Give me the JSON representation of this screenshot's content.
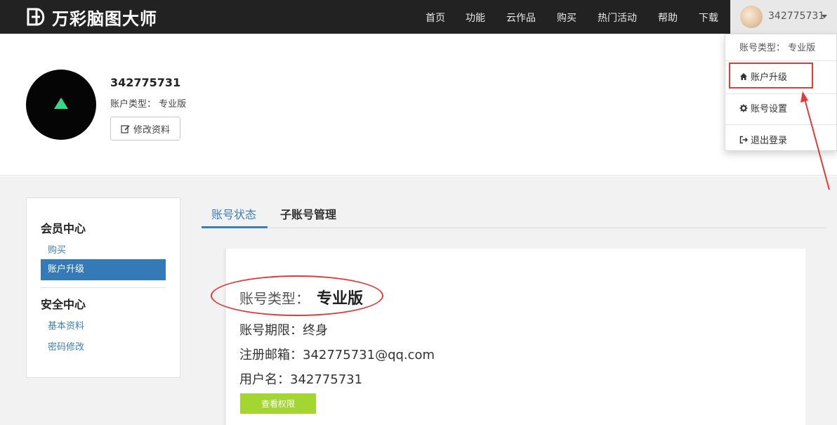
{
  "app": {
    "logo_text": "万彩脑图大师"
  },
  "nav": {
    "items": [
      "首页",
      "功能",
      "云作品",
      "购买",
      "热门活动",
      "帮助",
      "下载"
    ],
    "user_name": "342775731"
  },
  "dropdown": {
    "account_type": "账号类型： 专业版",
    "items": [
      {
        "label": "账户升级",
        "icon": "home-icon"
      },
      {
        "label": "账号设置",
        "icon": "gear-icon"
      },
      {
        "label": "退出登录",
        "icon": "logout-icon"
      }
    ]
  },
  "profile": {
    "name": "342775731",
    "account_type": "账户类型： 专业版",
    "edit_label": "修改资料"
  },
  "sidebar": {
    "member_heading": "会员中心",
    "buy": "购买",
    "upgrade": "账户升级",
    "security_heading": "安全中心",
    "basic_info": "基本资料",
    "password": "密码修改"
  },
  "tabs": {
    "status": "账号状态",
    "sub_accounts": "子账号管理"
  },
  "account": {
    "type_label": "账号类型：",
    "type_value": "专业版",
    "period": "账号期限：终身",
    "email": "注册邮箱：342775731@qq.com",
    "username": "用户名：342775731",
    "view_button": "查看权限"
  },
  "colors": {
    "topbar": "#222222",
    "primary": "#337ab7",
    "link": "#3c7fb6",
    "green_button": "#a3d630",
    "annotation_red": "#e03a3a"
  }
}
